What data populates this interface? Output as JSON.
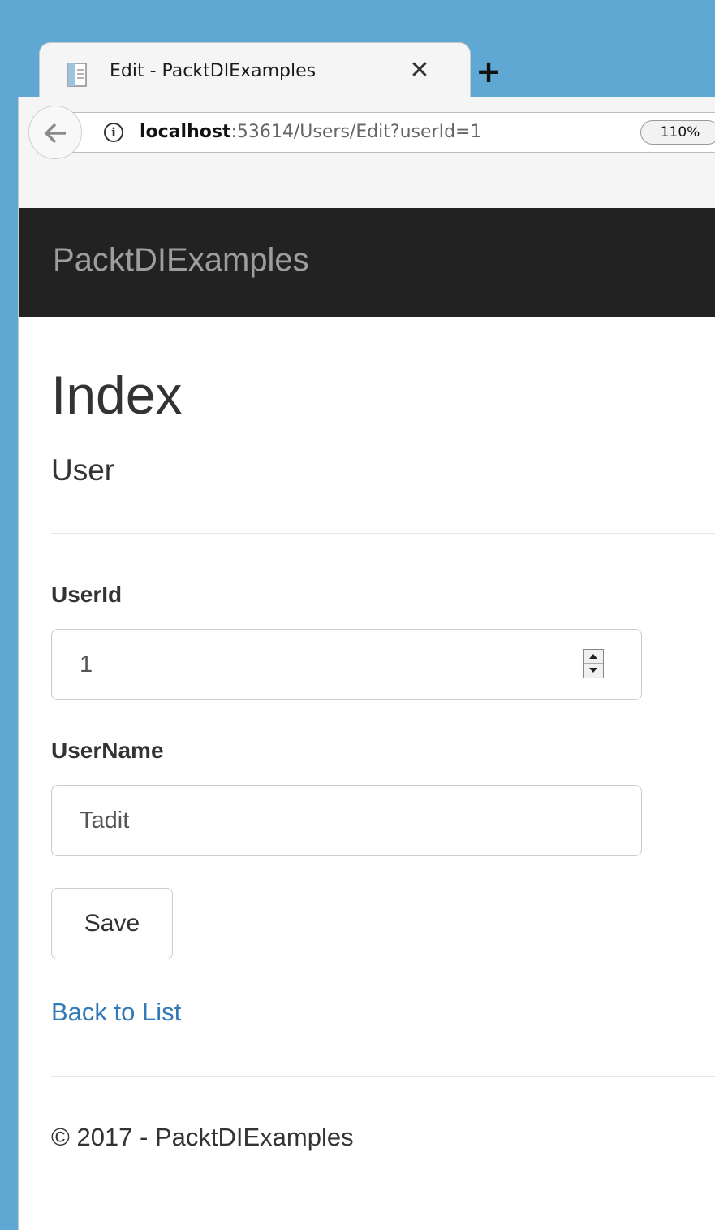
{
  "browser": {
    "tab_title": "Edit - PacktDIExamples",
    "tab_close_glyph": "✕",
    "new_tab_glyph": "+",
    "url_host": "localhost",
    "url_rest": ":53614/Users/Edit?userId=1",
    "zoom_level": "110%",
    "info_glyph": "i",
    "icons": {
      "favicon": "page-icon",
      "back": "back-arrow-icon",
      "info": "info-icon"
    }
  },
  "navbar": {
    "brand": "PacktDIExamples"
  },
  "page": {
    "title": "Index",
    "subtitle": "User"
  },
  "form": {
    "userid_label": "UserId",
    "userid_value": "1",
    "username_label": "UserName",
    "username_value": "Tadit",
    "save_label": "Save"
  },
  "links": {
    "back_to_list": "Back to List"
  },
  "footer": {
    "text": "© 2017 - PacktDIExamples"
  },
  "colors": {
    "window_frame": "#5fa8d3",
    "navbar_bg": "#222222",
    "brand_text": "#9d9d9d",
    "link": "#337ab7",
    "text": "#333333"
  }
}
